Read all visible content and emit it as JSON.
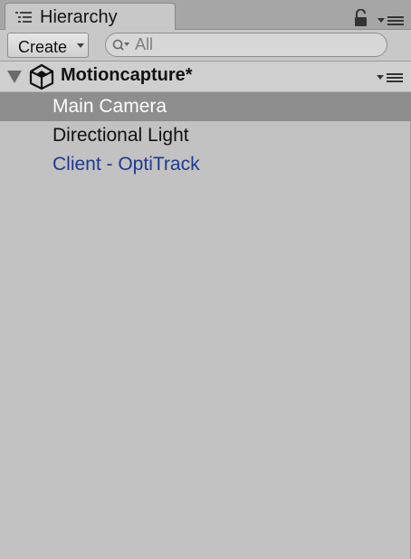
{
  "window": {
    "tab_title": "Hierarchy",
    "icons": {
      "tab": "hierarchy-list-icon",
      "lock": "lock-icon",
      "menu": "panel-menu-icon"
    }
  },
  "toolbar": {
    "create_label": "Create",
    "search_placeholder": "All"
  },
  "scene": {
    "name": "Motioncapture*",
    "expanded": true
  },
  "objects": [
    {
      "label": "Main Camera",
      "selected": true,
      "kind": "gameobject"
    },
    {
      "label": "Directional Light",
      "selected": false,
      "kind": "gameobject"
    },
    {
      "label": "Client - OptiTrack",
      "selected": false,
      "kind": "prefab"
    }
  ],
  "colors": {
    "panel_bg": "#c2c2c2",
    "selection_bg": "#8e8e8e",
    "prefab_text": "#1d3a8f"
  }
}
